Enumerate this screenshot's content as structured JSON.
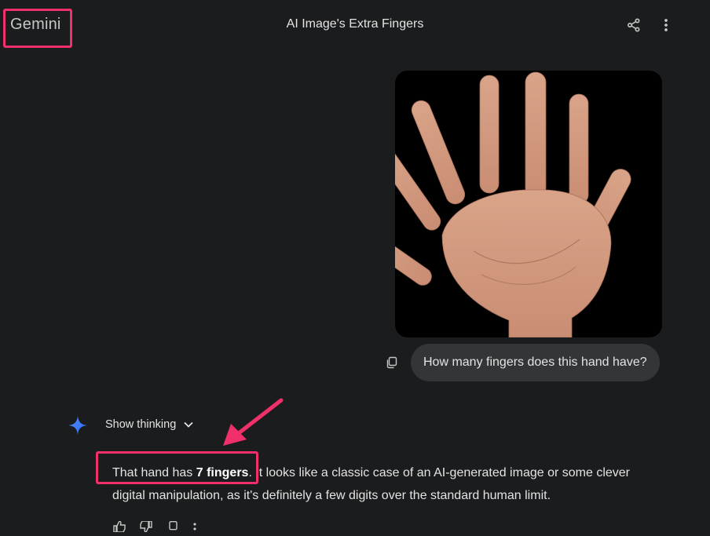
{
  "header": {
    "brand": "Gemini",
    "title": "AI Image's Extra Fingers"
  },
  "user_message": {
    "image_subject": "hand with extra fingers",
    "text": "How many fingers does this hand have?"
  },
  "response": {
    "thinking_toggle_label": "Show thinking",
    "answer_prefix": "That hand has ",
    "answer_bold": "7 fingers",
    "answer_rest": ". It looks like a classic case of an AI-generated image or some clever digital manipulation, as it's definitely a few digits over the standard human limit."
  },
  "annotations": {
    "highlight_color": "#f0306b"
  },
  "icons": [
    "share-icon",
    "more-vert-icon",
    "copy-icon",
    "gemini-sparkle-icon",
    "chevron-down-icon",
    "thumb-up-icon",
    "thumb-down-icon",
    "copy-icon",
    "more-vert-icon"
  ]
}
